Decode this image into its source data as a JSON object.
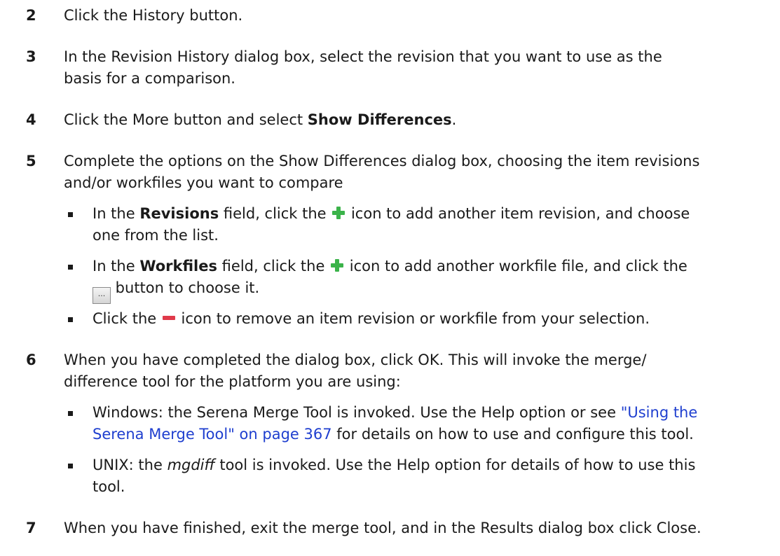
{
  "steps": [
    {
      "num": "2",
      "text": "Click the History button."
    },
    {
      "num": "3",
      "line1": "In the Revision History dialog box, select the revision that you want to use as the",
      "line2": "basis for a comparison."
    },
    {
      "num": "4",
      "pre": "Click the More button and select ",
      "bold": "Show Differences",
      "post": "."
    },
    {
      "num": "5",
      "line1": "Complete the options on the Show Differences dialog box, choosing the item revisions",
      "line2": "and/or workfiles you want to compare"
    },
    {
      "num": "6",
      "line1": "When you have completed the dialog box, click OK. This will invoke the merge/",
      "line2": "difference tool for the platform you are using:"
    },
    {
      "num": "7",
      "text": "When you have finished, exit the merge tool, and in the Results dialog box click Close."
    }
  ],
  "step5_bullets": {
    "b1": {
      "pre": "In the ",
      "bold": "Revisions",
      "mid": " field, click the",
      "post": " icon to add another item revision, and choose",
      "line2": "one from the list."
    },
    "b2": {
      "pre": "In the ",
      "bold": "Workfiles",
      "mid": " field, click the",
      "post": " icon to add another workfile file, and click the",
      "line2_post": " button to choose it.",
      "browse_label": "..."
    },
    "b3": {
      "pre": "Click the",
      "post": " icon to remove an item revision or workfile from your selection."
    }
  },
  "step6_bullets": {
    "b1": {
      "pre": "Windows: the Serena Merge Tool is invoked. Use the Help option or see ",
      "link1": "\"Using the",
      "link2": "Serena Merge Tool\" on page 367",
      "post": " for details on how to use and configure this tool."
    },
    "b2": {
      "pre": "UNIX: the ",
      "ital": "mgdiff",
      "post": " tool is invoked. Use the Help option for details of how to use this",
      "line2": "tool."
    }
  },
  "icons": {
    "plus": "plus-icon",
    "minus": "minus-icon",
    "browse": "browse-button-icon"
  },
  "colors": {
    "plus": "#3bb34a",
    "minus": "#e03a4a",
    "link": "#1f3fcf"
  }
}
